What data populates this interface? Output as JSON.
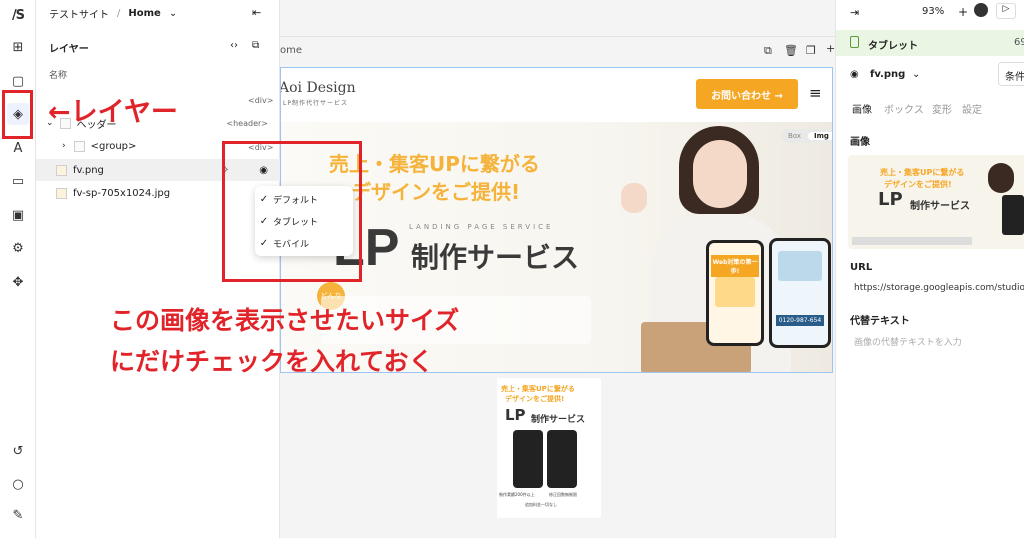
{
  "app": {
    "logo": "/S"
  },
  "layers_panel": {
    "site_name": "テストサイト",
    "separator": "/",
    "page_name": "Home",
    "title": "レイヤー",
    "column_header": "名称",
    "rows": [
      {
        "label": "ヘッダー",
        "tag": "<header>"
      },
      {
        "label": "<group>",
        "tag": ""
      },
      {
        "label": "fv.png",
        "tag": ""
      },
      {
        "label": "fv-sp-705x1024.jpg",
        "tag": ""
      }
    ],
    "div_tags": [
      "<div>",
      "<div>"
    ],
    "menu": {
      "items": [
        {
          "label": "デフォルト",
          "checked": true
        },
        {
          "label": "タブレット",
          "checked": true
        },
        {
          "label": "モバイル",
          "checked": true
        }
      ]
    }
  },
  "canvas": {
    "breadcrumb": "ome",
    "lp": {
      "logo_main": "Aoi Design",
      "logo_sub": "LP制作代行サービス",
      "cta": "お問い合わせ →",
      "headline1": "売上・集客UPに繋がる",
      "headline2": "デザインをご提供!",
      "service_en": "LANDING PAGE SERVICE",
      "service_big": "LP",
      "service_ja": "制作サービス",
      "toggle_box": "Box",
      "toggle_img": "Img",
      "badge": "どんな",
      "phone1_text": "Web対策の第一歩!",
      "phone2_text": "0120-987-654"
    },
    "sp_preview": {
      "headline1": "売上・集客UPに繋がる",
      "headline2": "デザインをご提供!",
      "big": "LP",
      "ja": "制作サービス",
      "feat1": "制作実績200件以上",
      "feat2": "修正回数無制限",
      "feat3": "追加料金一切なし"
    }
  },
  "props_panel": {
    "zoom": "93%",
    "breakpoint": "タブレット",
    "breakpoint_num": "69",
    "element_name": "fv.png",
    "condition_btn": "条件",
    "tabs": [
      "画像",
      "ボックス",
      "変形",
      "設定"
    ],
    "section_image": "画像",
    "preview_headline1": "売上・集客UPに繋がる",
    "preview_headline2": "デザインをご提供!",
    "preview_big": "LP",
    "preview_ja": "制作サービス",
    "url_label": "URL",
    "url_value": "https://storage.googleapis.com/studio-de",
    "alt_label": "代替テキスト",
    "alt_placeholder": "画像の代替テキストを入力"
  },
  "annotations": {
    "layer_label": "←レイヤー",
    "note_line1": "この画像を表示させたいサイズ",
    "note_line2": "にだけチェックを入れておく"
  },
  "colors": {
    "accent_orange": "#f5a623",
    "annotation_red": "#e0242a",
    "breakpoint_green": "#eaf6e4"
  }
}
